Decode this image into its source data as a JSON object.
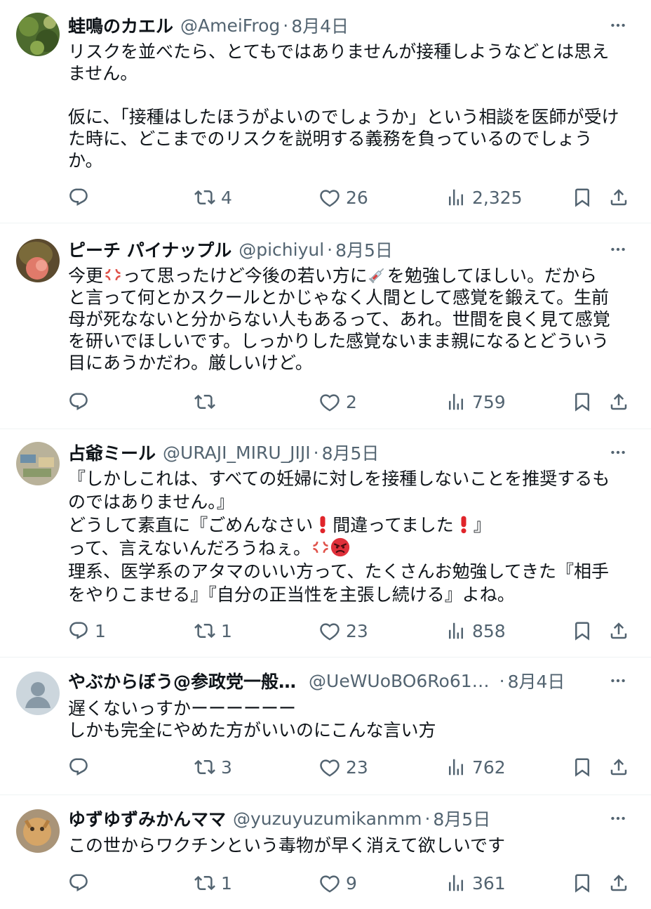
{
  "tweets": [
    {
      "name": "蛙鳴のカエル",
      "handle": "@AmeiFrog",
      "date": "8月4日",
      "lines": [
        "リスクを並べたら、とてもではありませんが接種しようなどとは思え",
        "ません。",
        "",
        "仮に、「接種はしたほうがよいのでしょうか」という相談を医師が受け",
        "た時に、どこまでのリスクを説明する義務を負っているのでしょう",
        "か。"
      ],
      "replies": "",
      "retweets": "4",
      "likes": "26",
      "views": "2,325"
    },
    {
      "name": "ピーチ パイナップル",
      "handle": "@pichiyul",
      "date": "8月5日",
      "line1_a": "今更",
      "line1_b": "って思ったけど今後の若い方に",
      "line1_c": "を勉強してほしい。だから",
      "lines": [
        "と言って何とかスクールとかじゃなく人間として感覚を鍛えて。生前",
        "母が死なないと分からない人もあるって、あれ。世間を良く見て感覚",
        "を研いでほしいです。しっかりした感覚ないまま親になるとどういう",
        "目にあうかだわ。厳しいけど。"
      ],
      "replies": "",
      "retweets": "",
      "likes": "2",
      "views": "759"
    },
    {
      "name": "占爺ミール",
      "handle": "@URAJI_MIRU_JIJI",
      "date": "8月5日",
      "line1": "『しかしこれは、すべての妊婦に対しを接種しないことを推奨するも",
      "line2": "のではありません。』",
      "line3_a": "どうして素直に『ごめんなさい",
      "line3_b": "間違ってました",
      "line3_c": "』",
      "line4": "って、言えないんだろうねぇ。",
      "line5": "理系、医学系のアタマのいい方って、たくさんお勉強してきた『相手",
      "line6": "をやりこませる』『自分の正当性を主張し続ける』よね。",
      "replies": "1",
      "retweets": "1",
      "likes": "23",
      "views": "858"
    },
    {
      "name": "やぶからぼう@参政党一般…",
      "handle": "@UeWUoBO6Ro61…",
      "date": "8月4日",
      "lines": [
        "遅くないっすかーーーーーー",
        "しかも完全にやめた方がいいのにこんな言い方"
      ],
      "replies": "",
      "retweets": "3",
      "likes": "23",
      "views": "762"
    },
    {
      "name": "ゆずゆずみかんママ",
      "handle": "@yuzuyuzumikanmm",
      "date": "8月5日",
      "lines": [
        "この世からワクチンという毒物が早く消えて欲しいです"
      ],
      "replies": "",
      "retweets": "1",
      "likes": "9",
      "views": "361"
    }
  ],
  "sep": "·",
  "colors": {
    "text": "#0f1419",
    "secondary": "#536471",
    "divider": "#eff3f4"
  },
  "icons": [
    "reply-icon",
    "retweet-icon",
    "like-icon",
    "views-icon",
    "bookmark-icon",
    "share-icon",
    "more-icon",
    "anger-emoji",
    "syringe-emoji",
    "exclamation-emoji",
    "angry-face-emoji"
  ]
}
